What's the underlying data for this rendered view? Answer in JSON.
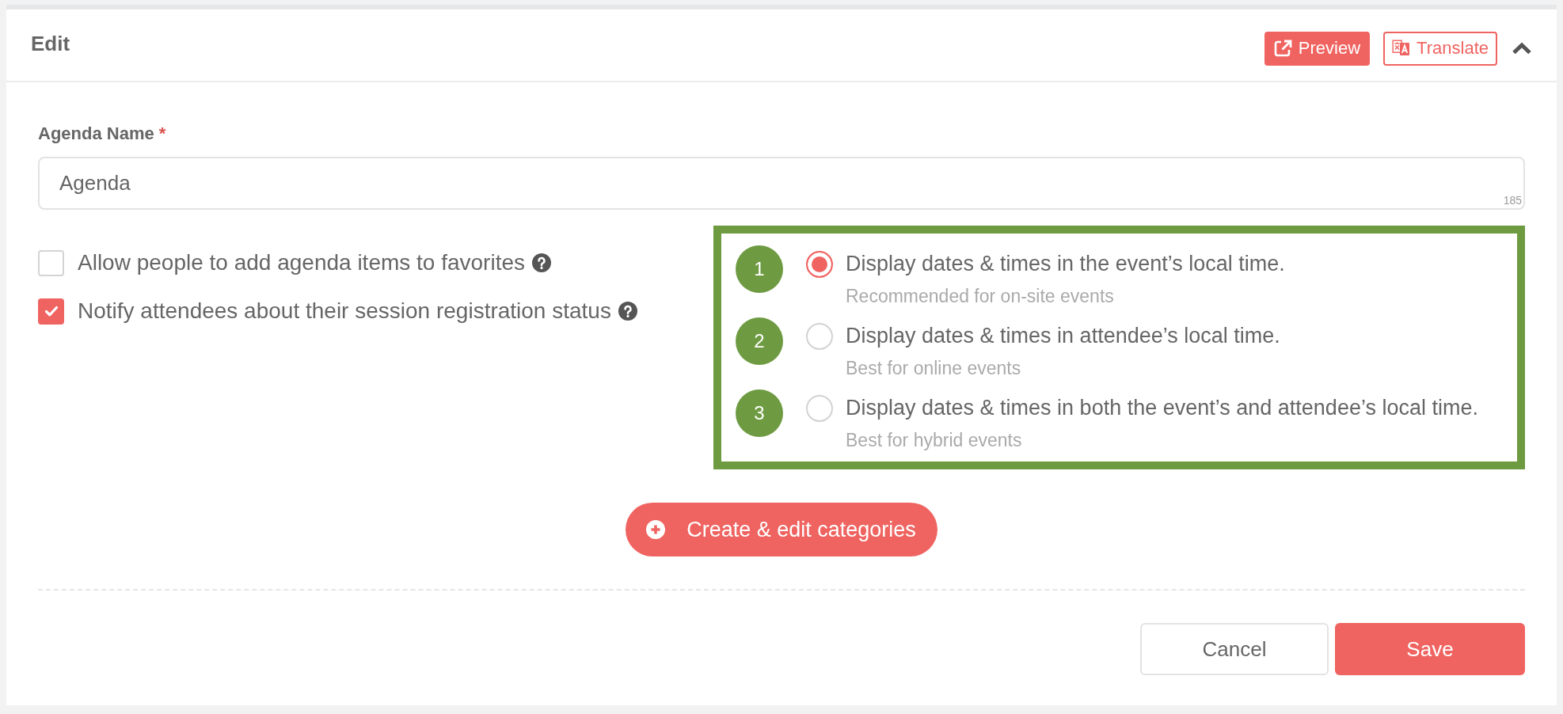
{
  "header": {
    "title": "Edit",
    "buttons": [
      {
        "label": "Preview",
        "kind": "filled"
      },
      {
        "label": "Translate",
        "kind": "outline"
      }
    ],
    "expanded": true
  },
  "agenda_name": {
    "label": "Agenda Name",
    "required_mark": "*",
    "value": "Agenda",
    "counter": "185"
  },
  "options": [
    {
      "label": "Allow people to add agenda items to favorites",
      "checked": false
    },
    {
      "label": "Notify attendees about their session registration status",
      "checked": true
    }
  ],
  "time_display": {
    "choices": [
      {
        "number": "1",
        "label": "Display dates & times in the event’s local time.",
        "hint": "Recommended for on-site events",
        "selected": true
      },
      {
        "number": "2",
        "label": "Display dates & times in attendee’s local time.",
        "hint": "Best for online events",
        "selected": false
      },
      {
        "number": "3",
        "label": "Display dates & times in both the event’s and attendee’s local time.",
        "hint": "Best for hybrid events",
        "selected": false
      }
    ]
  },
  "categories_button": {
    "label": "Create & edit categories"
  },
  "footer": {
    "buttons": [
      {
        "label": "Cancel",
        "kind": "secondary"
      },
      {
        "label": "Save",
        "kind": "primary"
      }
    ]
  }
}
